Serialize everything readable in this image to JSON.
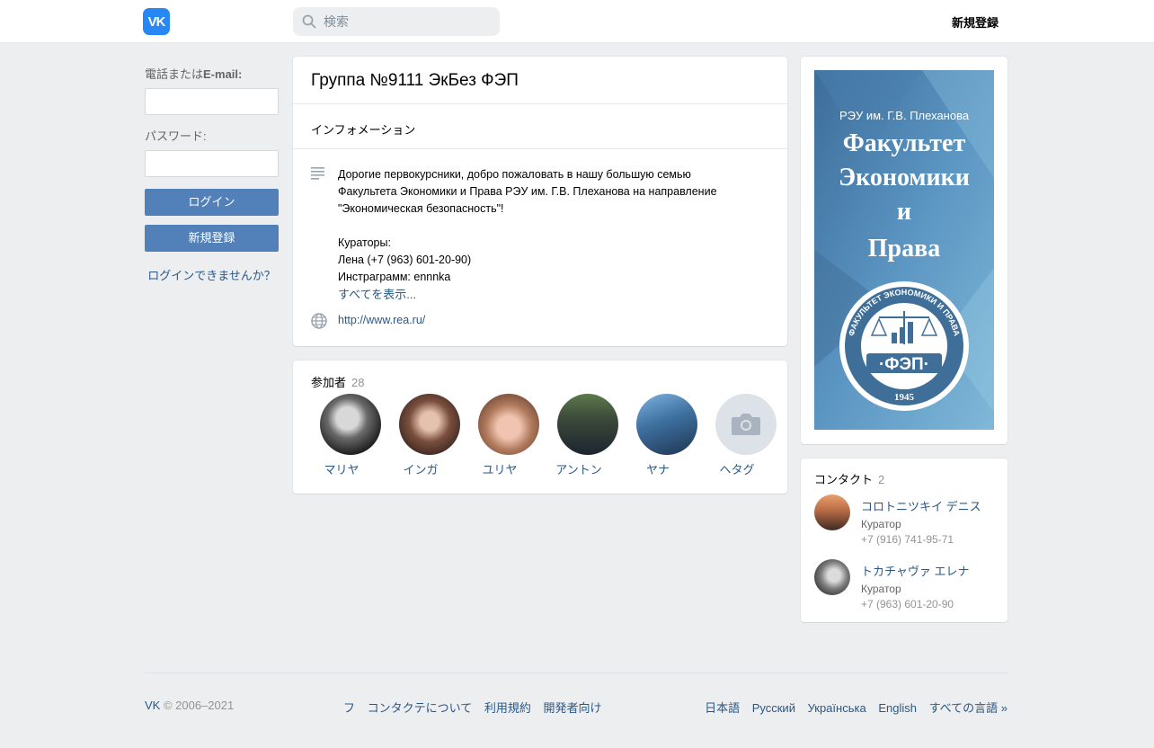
{
  "header": {
    "logo_text": "VK",
    "search_placeholder": "検索",
    "register_label": "新規登録"
  },
  "login": {
    "phone_label_prefix": "電話または",
    "phone_label_bold": "E-mail:",
    "password_label": "パスワード:",
    "login_button": "ログイン",
    "register_button": "新規登録",
    "forgot_link": "ログインできませんか？"
  },
  "group": {
    "title": "Группа №9111 ЭкБез ФЭП",
    "info_tab": "インフォメーション",
    "description_lines": [
      "Дорогие первокурсники, добро пожаловать в нашу большую семью",
      "Факультета Экономики и Права РЭУ им. Г.В. Плеханова на направление",
      "\"Экономическая безопасность\"!",
      "",
      "Кураторы:",
      "Лена (+7 (963) 601-20-90)",
      "Инстраграмм: ennnka"
    ],
    "show_more": "すべてを表示...",
    "website": "http://www.rea.ru/"
  },
  "members": {
    "title": "参加者",
    "count": "28",
    "items": [
      {
        "name": "マリヤ",
        "avatar": "photo"
      },
      {
        "name": "インガ",
        "avatar": "photo"
      },
      {
        "name": "ユリヤ",
        "avatar": "photo"
      },
      {
        "name": "アントン",
        "avatar": "photo"
      },
      {
        "name": "ヤナ",
        "avatar": "photo"
      },
      {
        "name": "ヘタグ",
        "avatar": "camera-icon"
      }
    ]
  },
  "poster": {
    "university": "РЭУ им. Г.В. Плеханова",
    "line1": "Факультет",
    "line2": "Экономики",
    "line3": "и",
    "line4": "Права",
    "seal_ring": "ФАКУЛЬТЕТ ЭКОНОМИКИ И ПРАВА",
    "seal_abbr": "·ФЭП·",
    "seal_year": "1945"
  },
  "contacts": {
    "title": "コンタクト",
    "count": "2",
    "items": [
      {
        "name": "コロトニツキイ デニス",
        "role": "Куратор",
        "phone": "+7 (916) 741-95-71"
      },
      {
        "name": "トカチャヴァ エレナ",
        "role": "Куратор",
        "phone": "+7 (963) 601-20-90"
      }
    ]
  },
  "footer": {
    "brand": "VK",
    "copyright": "© 2006–2021",
    "links": [
      "フ",
      "コンタクテについて",
      "利用規約",
      "開発者向け"
    ],
    "languages": [
      "日本語",
      "Русский",
      "Українська",
      "English",
      "すべての言語 »"
    ]
  },
  "colors": {
    "accent": "#5181b8",
    "link": "#2a5885",
    "logo": "#2787f5",
    "background": "#edeef0"
  }
}
